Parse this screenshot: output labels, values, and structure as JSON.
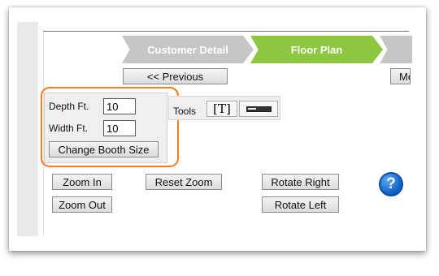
{
  "steps": [
    {
      "label": "Customer Detail"
    },
    {
      "label": "Floor Plan"
    },
    {
      "label": ""
    }
  ],
  "nav": {
    "previous_label": "<< Previous",
    "more_label": "Mo"
  },
  "booth": {
    "depth_label": "Depth Ft.",
    "depth_value": "10",
    "width_label": "Width Ft.",
    "width_value": "10",
    "change_button": "Change Booth Size"
  },
  "tools": {
    "label": "Tools",
    "text_tool": "T",
    "items": [
      "text-tool",
      "line-tool"
    ]
  },
  "zoom": {
    "zoom_in": "Zoom In",
    "zoom_out": "Zoom Out",
    "reset": "Reset Zoom",
    "rotate_right": "Rotate Right",
    "rotate_left": "Rotate Left"
  },
  "help": {
    "glyph": "?"
  },
  "colors": {
    "active_step": "#8dc63f",
    "inactive_step": "#c4c6c7",
    "highlight": "#ff7a1a",
    "help_icon": "#1a6fd6"
  }
}
